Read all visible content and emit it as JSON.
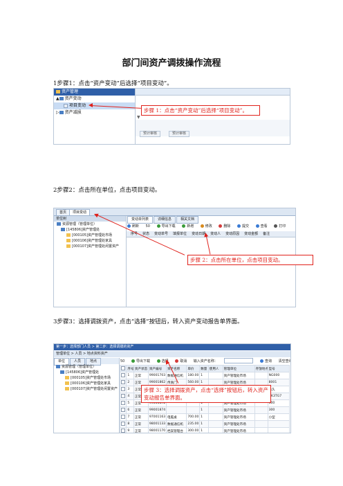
{
  "document": {
    "title": "部门间资产调拨操作流程",
    "steps": [
      "1步骤1：点击“资产变动”后选择“项目变动”。",
      "2步骤2：点击所在单位，点击项目变动。",
      "3步骤3：选择调拨资产，点击“选择”按钮后，转入资产变动报告单界面。"
    ]
  },
  "shot1": {
    "panel_title": "资产管理",
    "tree": [
      "资产变动",
      "项目变动",
      "资产减损"
    ],
    "buttons": [
      "预计审核",
      "预计审核"
    ],
    "callout": "步骤 1：点击“资产变动”后选择“项目变动”。"
  },
  "shot2": {
    "tabs": [
      "首页",
      "项目变动"
    ],
    "pane_title": "单位树",
    "tree": [
      "资源管理（管理单位）",
      "[145806]资产管理处",
      "[000105]资产管理处市场",
      "[000106]资产管理处家具",
      "[000107]资产管理处闲置资产"
    ],
    "subtabs": [
      "变动单列表",
      "详细信息",
      "相关文档"
    ],
    "toolbar": [
      "刷新",
      "50",
      "导出下载",
      "新增",
      "修改",
      "删除",
      "提交",
      "查看",
      "打印"
    ],
    "grid_headers": [
      "序号",
      "状态",
      "变动单号",
      "填报单位",
      "变动日期",
      "变动人",
      "变动原因",
      "变动金额",
      "备注"
    ],
    "callout": "步骤 2：点击所在单位，点击项目变动。"
  },
  "shot3": {
    "top_bar": "第一步：选择部门人员 > 第二步：选择调拨的资产",
    "filter_bar": "管理单位 > 人员 > 地点资料资产",
    "left_tabs": [
      "单位",
      "人员",
      "地点"
    ],
    "tree": [
      "资源管理（管理单位）",
      "[145806]资产管理处",
      "[000105]资产管理处市场",
      "[000106]资产管理处家具",
      "[000107]资产管理处闲置资产"
    ],
    "toolbar": [
      "50",
      "导出下载",
      "选择",
      "取消",
      "输入资产名称：",
      "查询",
      "清空查询"
    ],
    "grid_headers": [
      "",
      "序号",
      "资产状态",
      "资产编号",
      "资产名称",
      "单价",
      "数量",
      "使用人",
      "管理单位",
      "存放地点",
      "型号"
    ],
    "rows": [
      [
        "1",
        "正常",
        "99001703",
        "数据通信机",
        "180.00",
        "1",
        "资产管理处市场",
        "NG000"
      ],
      [
        "2",
        "正常",
        "99001862",
        "传真门",
        "560.00",
        "1",
        "资产管理处市场",
        "8001"
      ],
      [
        "3",
        "正常",
        "99001864",
        "",
        "",
        "1",
        "资产管理处市场",
        "永久"
      ],
      [
        "4",
        "正常",
        "99001870",
        "",
        "",
        "1",
        "资产管理处市场",
        "NK3TG7"
      ],
      [
        "5",
        "正常",
        "99001872",
        "",
        "",
        "1",
        "资产管理处市场",
        "300"
      ],
      [
        "6",
        "正常",
        "99001874",
        "",
        "",
        "1",
        "资产管理处市场",
        "300"
      ],
      [
        "7",
        "正常",
        "97001163",
        "电脑桌",
        "700.00",
        "1",
        "资产管理处市场",
        "小型"
      ],
      [
        "8",
        "正常",
        "98001133",
        "数据通信机",
        "235.00",
        "1",
        "资产管理处市场",
        ""
      ],
      [
        "9",
        "正常",
        "98001170",
        "档案管理台",
        "300.00",
        "1",
        "资产管理处市场",
        ""
      ]
    ],
    "callout": "步骤 3：选择调拨资产，点击“选择”按钮后，转入资产变动报告单界面。"
  },
  "colors": {
    "accent": "#2f5fa8",
    "callout": "#e0201a"
  }
}
